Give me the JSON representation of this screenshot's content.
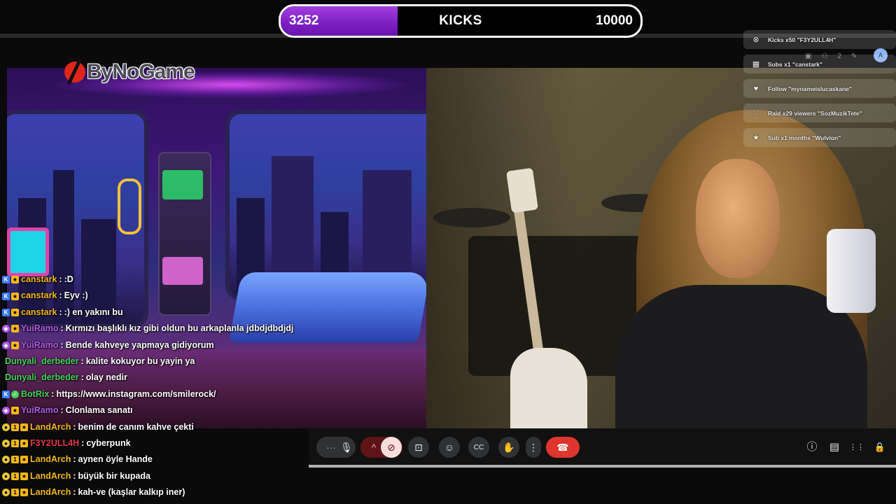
{
  "kicks_goal": {
    "current": "3252",
    "label": "KICKS",
    "goal": "10000",
    "progress_fraction": 0.3252,
    "fill_color": "#8a2be2"
  },
  "stream": {
    "logo_text": "ByNoGame"
  },
  "chat": {
    "messages": [
      {
        "user": "canstark",
        "user_color": "#f3b81a",
        "badges": [
          "kick-icon",
          "sub-icon"
        ],
        "text": ":D"
      },
      {
        "user": "canstark",
        "user_color": "#f3b81a",
        "badges": [
          "kick-icon",
          "sub-icon"
        ],
        "text": "Eyv :)"
      },
      {
        "user": "canstark",
        "user_color": "#f3b81a",
        "badges": [
          "kick-icon",
          "sub-icon"
        ],
        "text": ":) en yakını bu"
      },
      {
        "user": "YuiRamo",
        "user_color": "#b25be6",
        "badges": [
          "vip-icon",
          "sub-icon"
        ],
        "text": "Kırmızı başlıklı kız gibi oldun bu arkaplanla jdbdjdbdjdj"
      },
      {
        "user": "YuiRamo",
        "user_color": "#b25be6",
        "badges": [
          "vip-icon",
          "sub-icon"
        ],
        "text": "Bende kahveye yapmaya gidiyorum"
      },
      {
        "user": "Dunyali_derbeder",
        "user_color": "#47d35a",
        "badges": [],
        "text": "kalite kokuyor bu yayin ya"
      },
      {
        "user": "Dunyali_derbeder",
        "user_color": "#47d35a",
        "badges": [],
        "text": "olay nedir"
      },
      {
        "user": "BotRix",
        "user_color": "#47d35a",
        "badges": [
          "kick-icon",
          "bot-icon"
        ],
        "text": "https://www.instagram.com/smilerock/"
      },
      {
        "user": "YuiRamo",
        "user_color": "#b25be6",
        "badges": [
          "vip-icon",
          "sub-icon"
        ],
        "text": "Clonlama sanatı"
      },
      {
        "user": "LandArch",
        "user_color": "#f3b81a",
        "badges": [
          "og-icon",
          "gift-icon",
          "sub-icon"
        ],
        "text": "benim de canım kahve çekti"
      },
      {
        "user": "F3Y2ULL4H",
        "user_color": "#e4384f",
        "badges": [
          "og-icon",
          "gift-icon",
          "sub-icon"
        ],
        "text": "cyberpunk"
      },
      {
        "user": "LandArch",
        "user_color": "#f3b81a",
        "badges": [
          "og-icon",
          "gift-icon",
          "sub-icon"
        ],
        "text": "aynen öyle Hande"
      },
      {
        "user": "LandArch",
        "user_color": "#f3b81a",
        "badges": [
          "og-icon",
          "gift-icon",
          "sub-icon"
        ],
        "text": "büyük bir kupada"
      },
      {
        "user": "LandArch",
        "user_color": "#f3b81a",
        "badges": [
          "og-icon",
          "gift-icon",
          "sub-icon"
        ],
        "text": "kah-ve (kaşlar kalkıp iner)"
      }
    ]
  },
  "alerts": [
    {
      "icon": "kick-icon",
      "text": "Kicks x50 \"F3Y2ULL4H\""
    },
    {
      "icon": "gift-icon",
      "text": "Subs x1 \"canstark\""
    },
    {
      "icon": "heart-icon",
      "text": "Follow \"mynameislucaskane\""
    },
    {
      "icon": "raid-icon",
      "text": "Raid x29 viewers \"SozMuzikTete\""
    },
    {
      "icon": "star-icon",
      "text": "Sub x1 months \"Wulvion\""
    }
  ],
  "meet_controls": {
    "buttons": [
      {
        "name": "more-dots-icon",
        "glyph": "···"
      },
      {
        "name": "mic-icon",
        "glyph": "🎙"
      },
      {
        "name": "chevron-up-icon",
        "glyph": "^"
      },
      {
        "name": "camera-off-icon",
        "glyph": "⊘"
      },
      {
        "name": "present-icon",
        "glyph": "⊡"
      },
      {
        "name": "emoji-icon",
        "glyph": "☺"
      },
      {
        "name": "captions-icon",
        "glyph": "CC"
      },
      {
        "name": "raise-hand-icon",
        "glyph": "✋"
      },
      {
        "name": "options-icon",
        "glyph": "⋮"
      },
      {
        "name": "hangup-icon",
        "glyph": "☎"
      }
    ],
    "right_icons": [
      {
        "name": "info-icon",
        "glyph": "ⓘ"
      },
      {
        "name": "chat-icon",
        "glyph": "▤"
      },
      {
        "name": "apps-icon",
        "glyph": "⋮⋮"
      },
      {
        "name": "host-controls-icon",
        "glyph": "🔒"
      }
    ],
    "hangup_color": "#dc362e",
    "camera_off_color": "#f9dedc"
  },
  "tile_overlay": {
    "avatar_initial": "A",
    "count": "2"
  }
}
